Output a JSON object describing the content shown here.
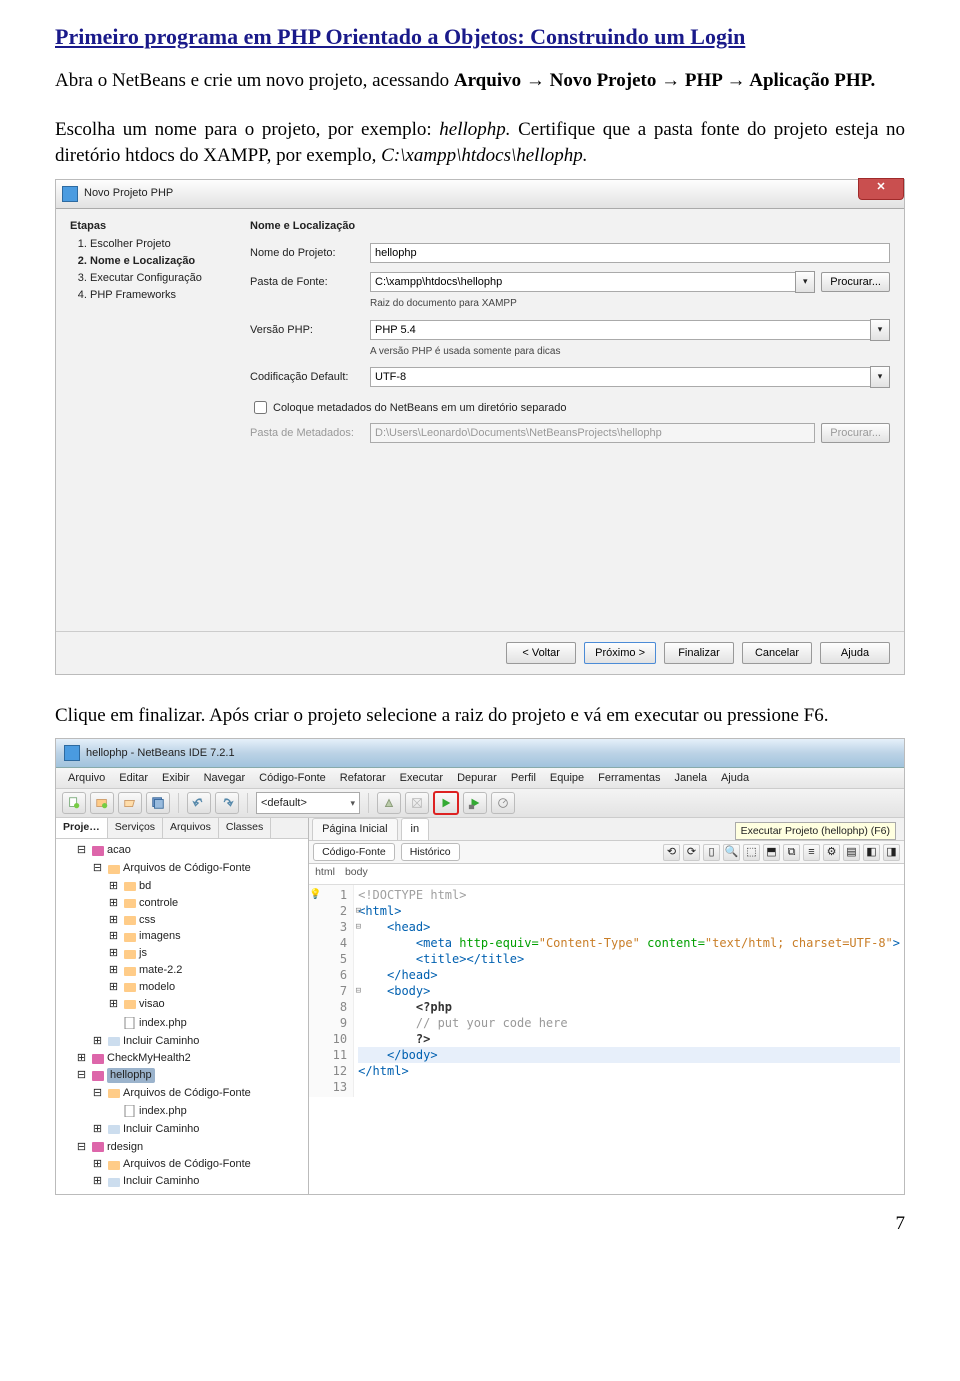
{
  "heading": "Primeiro programa em PHP Orientado a Objetos: Construindo um Login",
  "intro1_a": "Abra o NetBeans e crie um novo projeto, acessando ",
  "intro1_b": "Arquivo → Novo Projeto → PHP → Aplicação PHP.",
  "intro2_a": "Escolha um nome para o projeto, por exemplo: ",
  "intro2_b": "hellophp.",
  "intro2_c": " Certifique que a pasta fonte do projeto esteja no diretório htdocs do XAMPP, por exemplo, ",
  "intro2_d": "C:\\xampp\\htdocs\\hellophp.",
  "dialog": {
    "title": "Novo Projeto PHP",
    "stepsTitle": "Etapas",
    "steps": [
      "Escolher Projeto",
      "Nome e Localização",
      "Executar Configuração",
      "PHP Frameworks"
    ],
    "rightTitle": "Nome e Localização",
    "labels": {
      "nome": "Nome do Projeto:",
      "pasta": "Pasta de Fonte:",
      "raiz": "Raiz do documento para XAMPP",
      "versao": "Versão PHP:",
      "versaoHint": "A versão PHP é usada somente para dicas",
      "cod": "Codificação Default:",
      "check": "Coloque metadados do NetBeans em um diretório separado",
      "meta": "Pasta de Metadados:"
    },
    "values": {
      "nome": "hellophp",
      "pasta": "C:\\xampp\\htdocs\\hellophp",
      "versao": "PHP 5.4",
      "cod": "UTF-8",
      "meta": "D:\\Users\\Leonardo\\Documents\\NetBeansProjects\\hellophp",
      "procurar": "Procurar..."
    },
    "buttons": {
      "voltar": "< Voltar",
      "proximo": "Próximo >",
      "finalizar": "Finalizar",
      "cancelar": "Cancelar",
      "ajuda": "Ajuda"
    }
  },
  "mid_text": "Clique em finalizar. Após criar o projeto selecione a raiz do projeto e vá em executar ou pressione F6.",
  "ide": {
    "title": "hellophp - NetBeans IDE 7.2.1",
    "menu": [
      "Arquivo",
      "Editar",
      "Exibir",
      "Navegar",
      "Código-Fonte",
      "Refatorar",
      "Executar",
      "Depurar",
      "Perfil",
      "Equipe",
      "Ferramentas",
      "Janela",
      "Ajuda"
    ],
    "toolbar_dropdown": "<default>",
    "tooltip": "Executar Projeto (hellophp) (F6)",
    "panelTabs": [
      "Proje…",
      "Serviços",
      "Arquivos",
      "Classes"
    ],
    "tree": {
      "root1": "acao",
      "root1_cf": "Arquivos de Código-Fonte",
      "r1_items": [
        "bd",
        "controle",
        "css",
        "imagens",
        "js",
        "mate-2.2",
        "modelo",
        "visao"
      ],
      "r1_index": "index.php",
      "r1_inc": "Incluir Caminho",
      "root2": "CheckMyHealth2",
      "root3": "hellophp",
      "root3_cf": "Arquivos de Código-Fonte",
      "r3_index": "index.php",
      "r3_inc": "Incluir Caminho",
      "root4": "rdesign",
      "root4_cf": "Arquivos de Código-Fonte",
      "r4_inc": "Incluir Caminho"
    },
    "editorTabs": [
      "Página Inicial",
      "in"
    ],
    "subtabs": {
      "codigo": "Código-Fonte",
      "hist": "Histórico"
    },
    "breadcrumb": [
      "html",
      "body"
    ],
    "code": [
      {
        "n": "1",
        "html": "<span class='c-doctype'>&lt;!DOCTYPE html&gt;</span>"
      },
      {
        "n": "2",
        "html": "<span class='c-tag'>&lt;html&gt;</span>"
      },
      {
        "n": "3",
        "html": "    <span class='c-tag'>&lt;head&gt;</span>"
      },
      {
        "n": "4",
        "html": "        <span class='c-tag'>&lt;meta</span> <span class='c-attr'>http-equiv=</span><span class='c-str'>\"Content-Type\"</span> <span class='c-attr'>content=</span><span class='c-str'>\"text/html; charset=UTF-8\"</span><span class='c-tag'>&gt;</span>"
      },
      {
        "n": "5",
        "html": "        <span class='c-tag'>&lt;title&gt;&lt;/title&gt;</span>"
      },
      {
        "n": "6",
        "html": "    <span class='c-tag'>&lt;/head&gt;</span>"
      },
      {
        "n": "7",
        "html": "    <span class='c-tag'>&lt;body&gt;</span>"
      },
      {
        "n": "8",
        "html": "        <span class='c-phpopen'>&lt;?php</span>"
      },
      {
        "n": "9",
        "html": "        <span class='c-cmt'>// put your code here</span>"
      },
      {
        "n": "10",
        "html": "        <span class='c-phpopen'>?&gt;</span>"
      },
      {
        "n": "11",
        "html": "    <span class='c-tag'>&lt;/body&gt;</span>"
      },
      {
        "n": "12",
        "html": "<span class='c-tag'>&lt;/html&gt;</span>"
      },
      {
        "n": "13",
        "html": ""
      }
    ]
  },
  "page_number": "7"
}
